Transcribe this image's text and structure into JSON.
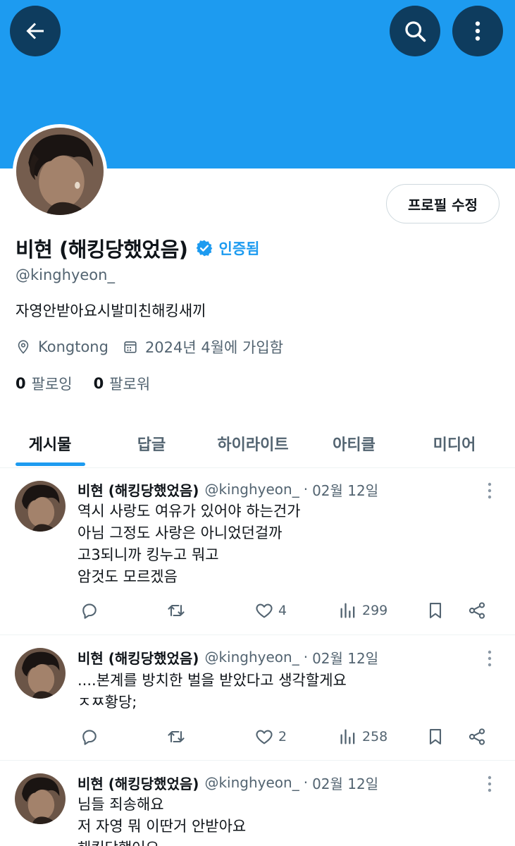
{
  "header": {
    "back_icon": "arrow-left-icon",
    "search_icon": "search-icon",
    "more_icon": "more-vertical-icon",
    "banner_color": "#1d9bf0"
  },
  "profile": {
    "display_name": "비현 (해킹당했었음)",
    "verified_label": "인증됨",
    "handle": "@kinghyeon_",
    "bio": "자영안받아요시발미친해킹새끼",
    "location": "Kongtong",
    "joined": "2024년 4월에 가입함",
    "edit_button": "프로필 수정",
    "following_count": "0",
    "following_label": "팔로잉",
    "followers_count": "0",
    "followers_label": "팔로워",
    "accent_color": "#1d9bf0"
  },
  "tabs": [
    {
      "label": "게시물",
      "active": true
    },
    {
      "label": "답글",
      "active": false
    },
    {
      "label": "하이라이트",
      "active": false
    },
    {
      "label": "아티클",
      "active": false
    },
    {
      "label": "미디어",
      "active": false
    }
  ],
  "posts": [
    {
      "name": "비현 (해킹당했었음)",
      "handle": "@kinghyeon_",
      "date": "02월 12일",
      "lines": [
        "역시 사랑도 여유가 있어야 하는건가",
        "아님 그정도 사랑은 아니었던걸까",
        "고3되니까 킹누고 뭐고",
        "암것도 모르겠음"
      ],
      "likes": "4",
      "views": "299"
    },
    {
      "name": "비현 (해킹당했었음)",
      "handle": "@kinghyeon_",
      "date": "02월 12일",
      "lines": [
        "....본계를 방치한 벌을 받았다고 생각할게요",
        "ㅈㅉ황당;"
      ],
      "likes": "2",
      "views": "258"
    },
    {
      "name": "비현 (해킹당했었음)",
      "handle": "@kinghyeon_",
      "date": "02월 12일",
      "lines": [
        "님들 죄송해요",
        "저 자영 뭐 이딴거 안받아요",
        "해킹당했어요"
      ],
      "likes": "",
      "views": ""
    }
  ]
}
